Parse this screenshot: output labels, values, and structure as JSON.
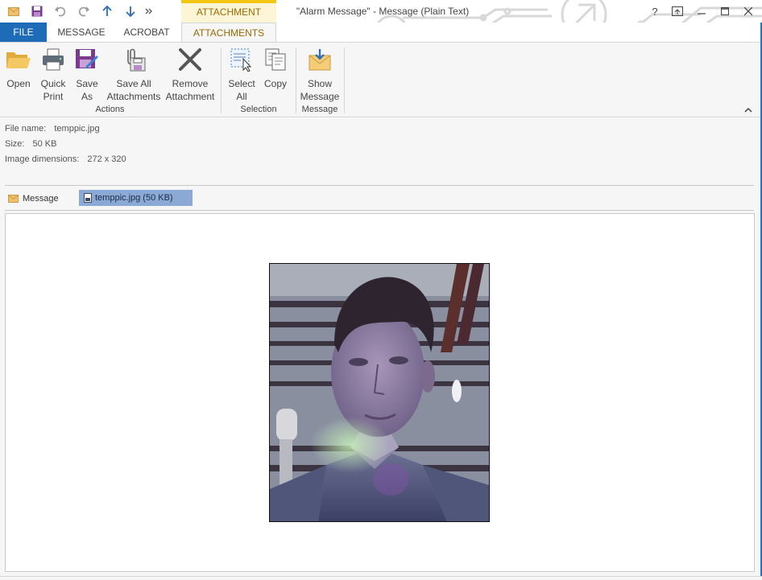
{
  "window": {
    "title": "\"Alarm Message\" - Message (Plain Text)",
    "context_tab_label": "ATTACHMENT TOOLS",
    "help_label": "?",
    "accent_color": "#1e6bb8",
    "context_color": "#f3c612"
  },
  "quick_access": [
    {
      "name": "envelope-icon"
    },
    {
      "name": "save-icon"
    },
    {
      "name": "undo-icon"
    },
    {
      "name": "redo-icon"
    },
    {
      "name": "up-arrow-icon"
    },
    {
      "name": "down-arrow-icon"
    },
    {
      "name": "more-icon"
    }
  ],
  "tabs": {
    "file": "FILE",
    "message": "MESSAGE",
    "acrobat": "ACROBAT",
    "attachments": "ATTACHMENTS"
  },
  "ribbon": {
    "actions": {
      "group_label": "Actions",
      "open": "Open",
      "quick_print_1": "Quick",
      "quick_print_2": "Print",
      "save_as_1": "Save",
      "save_as_2": "As",
      "save_all_1": "Save All",
      "save_all_2": "Attachments",
      "remove_1": "Remove",
      "remove_2": "Attachment"
    },
    "selection": {
      "group_label": "Selection",
      "select_all_1": "Select",
      "select_all_2": "All",
      "copy": "Copy"
    },
    "message": {
      "group_label": "Message",
      "show_message_1": "Show",
      "show_message_2": "Message"
    }
  },
  "file_info": {
    "name_label": "File name:",
    "name_value": "temppic.jpg",
    "size_label": "Size:",
    "size_value": "50 KB",
    "dims_label": "Image dimensions:",
    "dims_value": "272 x 320"
  },
  "attachment_bar": {
    "message_label": "Message",
    "file_label": "temppic.jpg (50 KB)"
  }
}
